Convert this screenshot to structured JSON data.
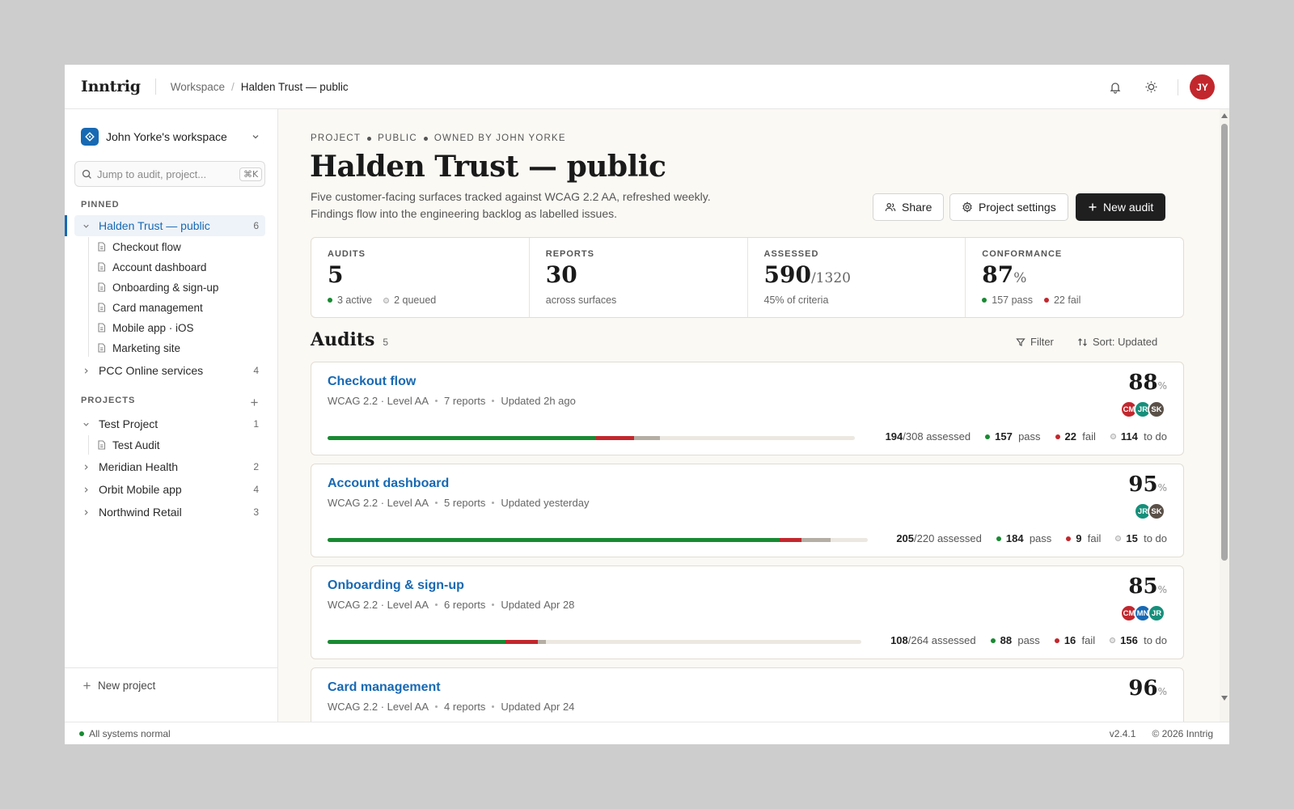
{
  "app": {
    "brand": "Inntrig"
  },
  "breadcrumb": {
    "workspace": "Workspace",
    "separator": "/",
    "current": "Halden Trust — public"
  },
  "user": {
    "initials": "JY"
  },
  "sidebar": {
    "workspace_name": "John Yorke's workspace",
    "search_placeholder": "Jump to audit, project...",
    "search_shortcut": "⌘K",
    "pinned_label": "PINNED",
    "pinned": [
      {
        "label": "Halden Trust — public",
        "count": "6",
        "expanded": true,
        "children": [
          "Checkout flow",
          "Account dashboard",
          "Onboarding & sign-up",
          "Card management",
          "Mobile app · iOS",
          "Marketing site"
        ]
      },
      {
        "label": "PCC Online services",
        "count": "4",
        "expanded": false
      }
    ],
    "projects_label": "PROJECTS",
    "projects": [
      {
        "label": "Test Project",
        "count": "1",
        "expanded": true,
        "children": [
          "Test Audit"
        ]
      },
      {
        "label": "Meridian Health",
        "count": "2"
      },
      {
        "label": "Orbit Mobile app",
        "count": "4"
      },
      {
        "label": "Northwind Retail",
        "count": "3"
      }
    ],
    "new_project": "New project"
  },
  "project": {
    "eyebrow": [
      "PROJECT",
      "PUBLIC",
      "OWNED BY JOHN YORKE"
    ],
    "title": "Halden Trust — public",
    "desc_line1": "Five customer-facing surfaces tracked against WCAG 2.2 AA, refreshed weekly.",
    "desc_line2": "Findings flow into the engineering backlog as labelled issues.",
    "share": "Share",
    "settings": "Project settings",
    "new_audit": "New audit"
  },
  "stats": {
    "audits": {
      "label": "AUDITS",
      "value": "5",
      "active": "3 active",
      "queued": "2 queued"
    },
    "reports": {
      "label": "REPORTS",
      "value": "30",
      "sub": "across surfaces"
    },
    "assessed": {
      "label": "ASSESSED",
      "value": "590",
      "of": "/1320",
      "sub": "45% of criteria"
    },
    "conformance": {
      "label": "CONFORMANCE",
      "value": "87",
      "unit": "%",
      "pass": "157 pass",
      "fail": "22 fail"
    }
  },
  "audits_header": {
    "title": "Audits",
    "count": "5",
    "filter": "Filter",
    "sort": "Sort: Updated"
  },
  "colors": {
    "accent": "#1769b3",
    "pass": "#198a32",
    "fail": "#c2272d",
    "todo": "#b5aea4",
    "dark": "#1f1f1f"
  },
  "audits": [
    {
      "title": "Checkout flow",
      "standard": "WCAG 2.2 · Level AA",
      "reports": "7",
      "reports_label": "reports",
      "updated_label": "Updated",
      "updated": "2h ago",
      "pct": "88",
      "pct_unit": "%",
      "assessed": "194",
      "total": "/308",
      "assessed_label": "assessed",
      "pass": "157",
      "fail": "22",
      "todo": "114",
      "pass_label": "pass",
      "fail_label": "fail",
      "todo_label": "to do",
      "avatars": [
        {
          "i": "CM",
          "c": "#c2272d"
        },
        {
          "i": "JR",
          "c": "#168f7a"
        },
        {
          "i": "SK",
          "c": "#5a5048"
        }
      ]
    },
    {
      "title": "Account dashboard",
      "standard": "WCAG 2.2 · Level AA",
      "reports": "5",
      "reports_label": "reports",
      "updated_label": "Updated",
      "updated": "yesterday",
      "pct": "95",
      "pct_unit": "%",
      "assessed": "205",
      "total": "/220",
      "assessed_label": "assessed",
      "pass": "184",
      "fail": "9",
      "todo": "15",
      "pass_label": "pass",
      "fail_label": "fail",
      "todo_label": "to do",
      "avatars": [
        {
          "i": "JR",
          "c": "#168f7a"
        },
        {
          "i": "SK",
          "c": "#5a5048"
        }
      ]
    },
    {
      "title": "Onboarding & sign-up",
      "standard": "WCAG 2.2 · Level AA",
      "reports": "6",
      "reports_label": "reports",
      "updated_label": "Updated",
      "updated": "Apr 28",
      "pct": "85",
      "pct_unit": "%",
      "assessed": "108",
      "total": "/264",
      "assessed_label": "assessed",
      "pass": "88",
      "fail": "16",
      "todo": "156",
      "pass_label": "pass",
      "fail_label": "fail",
      "todo_label": "to do",
      "avatars": [
        {
          "i": "CM",
          "c": "#c2272d"
        },
        {
          "i": "MN",
          "c": "#1769b3"
        },
        {
          "i": "JR",
          "c": "#168f7a"
        }
      ]
    },
    {
      "title": "Card management",
      "standard": "WCAG 2.2 · Level AA",
      "reports": "4",
      "reports_label": "reports",
      "updated_label": "Updated",
      "updated": "Apr 24",
      "pct": "96",
      "pct_unit": "%"
    }
  ],
  "footer": {
    "status": "All systems normal",
    "version": "v2.4.1",
    "copyright": "© 2026 Inntrig"
  }
}
